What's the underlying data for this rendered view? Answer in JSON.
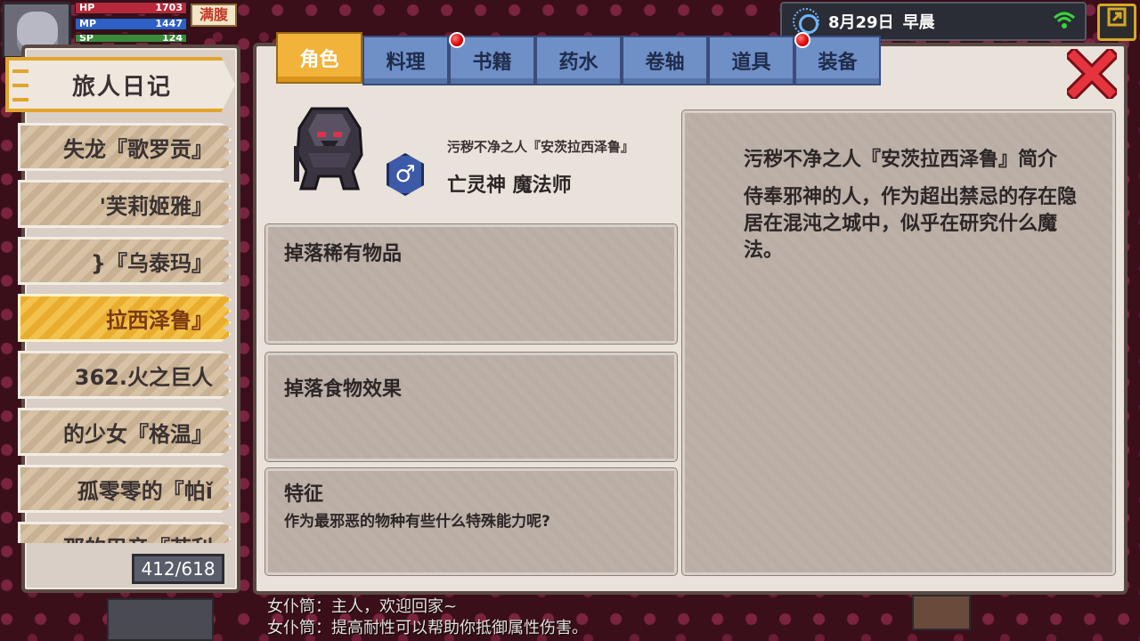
{
  "hud": {
    "hp_label": "HP",
    "hp_value": "1703",
    "mp_label": "MP",
    "mp_value": "1447",
    "sp_label": "SP",
    "sp_value": "124",
    "hunger_status": "满腹",
    "date": "8月29日",
    "time_of_day": "早晨"
  },
  "journal": {
    "title": "旅人日记",
    "entries": [
      "失龙『歌罗贡』",
      "'芙莉姬雅』",
      "}『乌泰玛』",
      "拉西泽鲁』",
      "362.火之巨人",
      "的少女『格温』",
      "孤零零的『帕ǐ",
      "那的巴音『若利"
    ],
    "selected_index": 3,
    "page_counter": "412/618"
  },
  "tabs": [
    {
      "label": "角色",
      "active": true,
      "badge": false
    },
    {
      "label": "料理",
      "active": false,
      "badge": false
    },
    {
      "label": "书籍",
      "active": false,
      "badge": true
    },
    {
      "label": "药水",
      "active": false,
      "badge": false
    },
    {
      "label": "卷轴",
      "active": false,
      "badge": false
    },
    {
      "label": "道具",
      "active": false,
      "badge": false
    },
    {
      "label": "装备",
      "active": false,
      "badge": true
    }
  ],
  "monster": {
    "name": "污秽不净之人『安茨拉西泽鲁』",
    "class": "亡灵神 魔法师",
    "gender_symbol": "♂"
  },
  "sections": {
    "drop_rare_title": "掉落稀有物品",
    "drop_food_title": "掉落食物效果",
    "traits_title": "特征",
    "traits_text": "作为最邪恶的物种有些什么特殊能力呢?"
  },
  "description": {
    "title": "污秽不净之人『安茨拉西泽鲁』简介",
    "text": "侍奉邪神的人，作为超出禁忌的存在隐居在混沌之城中，似乎在研究什么魔法。"
  },
  "chat": [
    "女仆筒：主人，欢迎回家~",
    "女仆筒：提高耐性可以帮助你抵御属性伤害。"
  ],
  "colors": {
    "active_tab": "#f2b33a",
    "tab": "#6f8fc7",
    "selected_entry": "#f3c24c",
    "close": "#e6343e"
  }
}
